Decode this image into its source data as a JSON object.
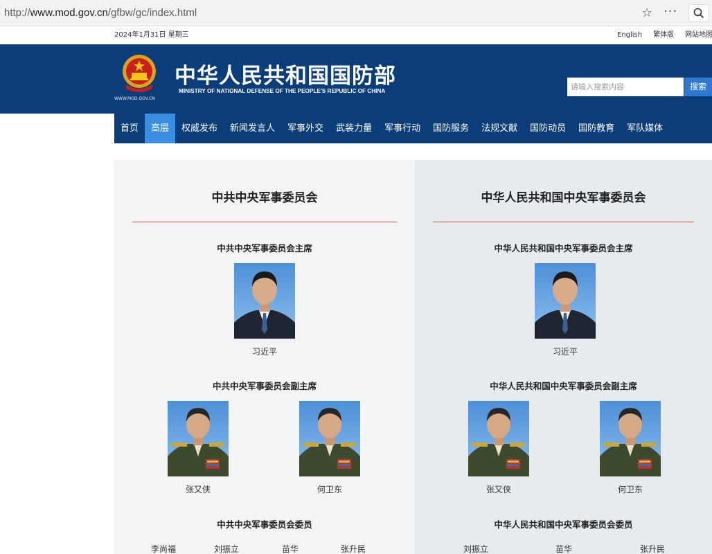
{
  "browser": {
    "url_scheme": "http://",
    "url_host": "www.mod.gov.cn",
    "url_path": "/gfbw/gc/index.html"
  },
  "utility": {
    "date": "2024年1月31日 星期三",
    "links": [
      "English",
      "繁体版",
      "网站地图"
    ]
  },
  "header": {
    "title": "中华人民共和国国防部",
    "subtitle": "MINISTRY OF NATIONAL DEFENSE OF THE PEOPLE'S REPUBLIC OF CHINA",
    "emblem_caption": "WWW.MOD.GOV.CN",
    "search_placeholder": "请输入搜索内容",
    "search_button": "搜索"
  },
  "nav": {
    "items": [
      "首页",
      "高层",
      "权威发布",
      "新闻发言人",
      "军事外交",
      "武装力量",
      "军事行动",
      "国防服务",
      "法规文献",
      "国防动员",
      "国防教育",
      "军队媒体"
    ],
    "active_index": 1
  },
  "left": {
    "title": "中共中央军事委员会",
    "chairman_heading": "中共中央军事委员会主席",
    "chairman": "习近平",
    "vice_heading": "中共中央军事委员会副主席",
    "vice": [
      "张又侠",
      "何卫东"
    ],
    "members_heading": "中共中央军事委员会委员",
    "members": [
      "李尚福",
      "刘振立",
      "苗华",
      "张升民"
    ]
  },
  "right": {
    "title": "中华人民共和国中央军事委员会",
    "chairman_heading": "中华人民共和国中央军事委员会主席",
    "chairman": "习近平",
    "vice_heading": "中华人民共和国中央军事委员会副主席",
    "vice": [
      "张又侠",
      "何卫东"
    ],
    "members_heading": "中华人民共和国中央军事委员会委员",
    "members": [
      "刘振立",
      "苗华",
      "张升民"
    ]
  },
  "colors": {
    "header_blue": "#0a3d7a",
    "nav_active": "#3a8ee0",
    "rule_red": "#d94a3b",
    "search_button": "#2f79d0"
  }
}
